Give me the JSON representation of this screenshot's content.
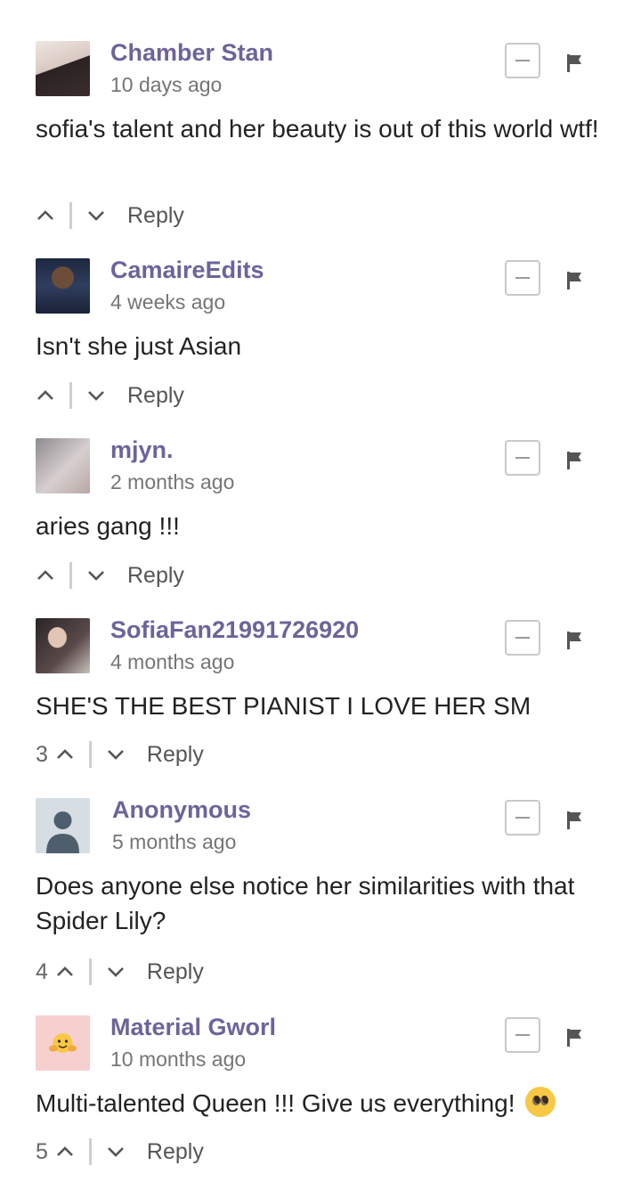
{
  "comments": [
    {
      "user": "Chamber Stan",
      "time": "10 days ago",
      "text": "sofia's talent and her beauty is out of this world wtf!",
      "votes": "",
      "reply": "Reply",
      "avatar": "photo-avatar",
      "avatar_color": "#d9c8c2"
    },
    {
      "user": "CamaireEdits",
      "time": "4 weeks ago",
      "text": "Isn't she just Asian",
      "votes": "",
      "reply": "Reply",
      "avatar": "photo-avatar",
      "avatar_color": "#2a3550"
    },
    {
      "user": "mjyn.",
      "time": "2 months ago",
      "text": "aries gang !!!",
      "votes": "",
      "reply": "Reply",
      "avatar": "photo-avatar",
      "avatar_color": "#b9b3b6"
    },
    {
      "user": "SofiaFan21991726920",
      "time": "4 months ago",
      "text": "SHE'S THE BEST PIANIST I LOVE HER SM",
      "votes": "3",
      "reply": "Reply",
      "avatar": "photo-avatar",
      "avatar_color": "#3b3030"
    },
    {
      "user": "Anonymous",
      "time": "5 months ago",
      "text": "Does anyone else notice her similarities with that Spider Lily?",
      "votes": "4",
      "reply": "Reply",
      "avatar": "default-user-avatar",
      "avatar_color": "#d6dde3"
    },
    {
      "user": "Material Gworl",
      "time": "10 months ago",
      "text": "Multi-talented Queen !!! Give us everything!",
      "votes": "5",
      "reply": "Reply",
      "avatar": "hugging-emoji-avatar",
      "avatar_color": "#f6cfcf",
      "emoji": "pleading-face-emoji"
    }
  ],
  "colors": {
    "username": "#6e6399",
    "timestamp": "#757575",
    "icon": "#555555"
  }
}
